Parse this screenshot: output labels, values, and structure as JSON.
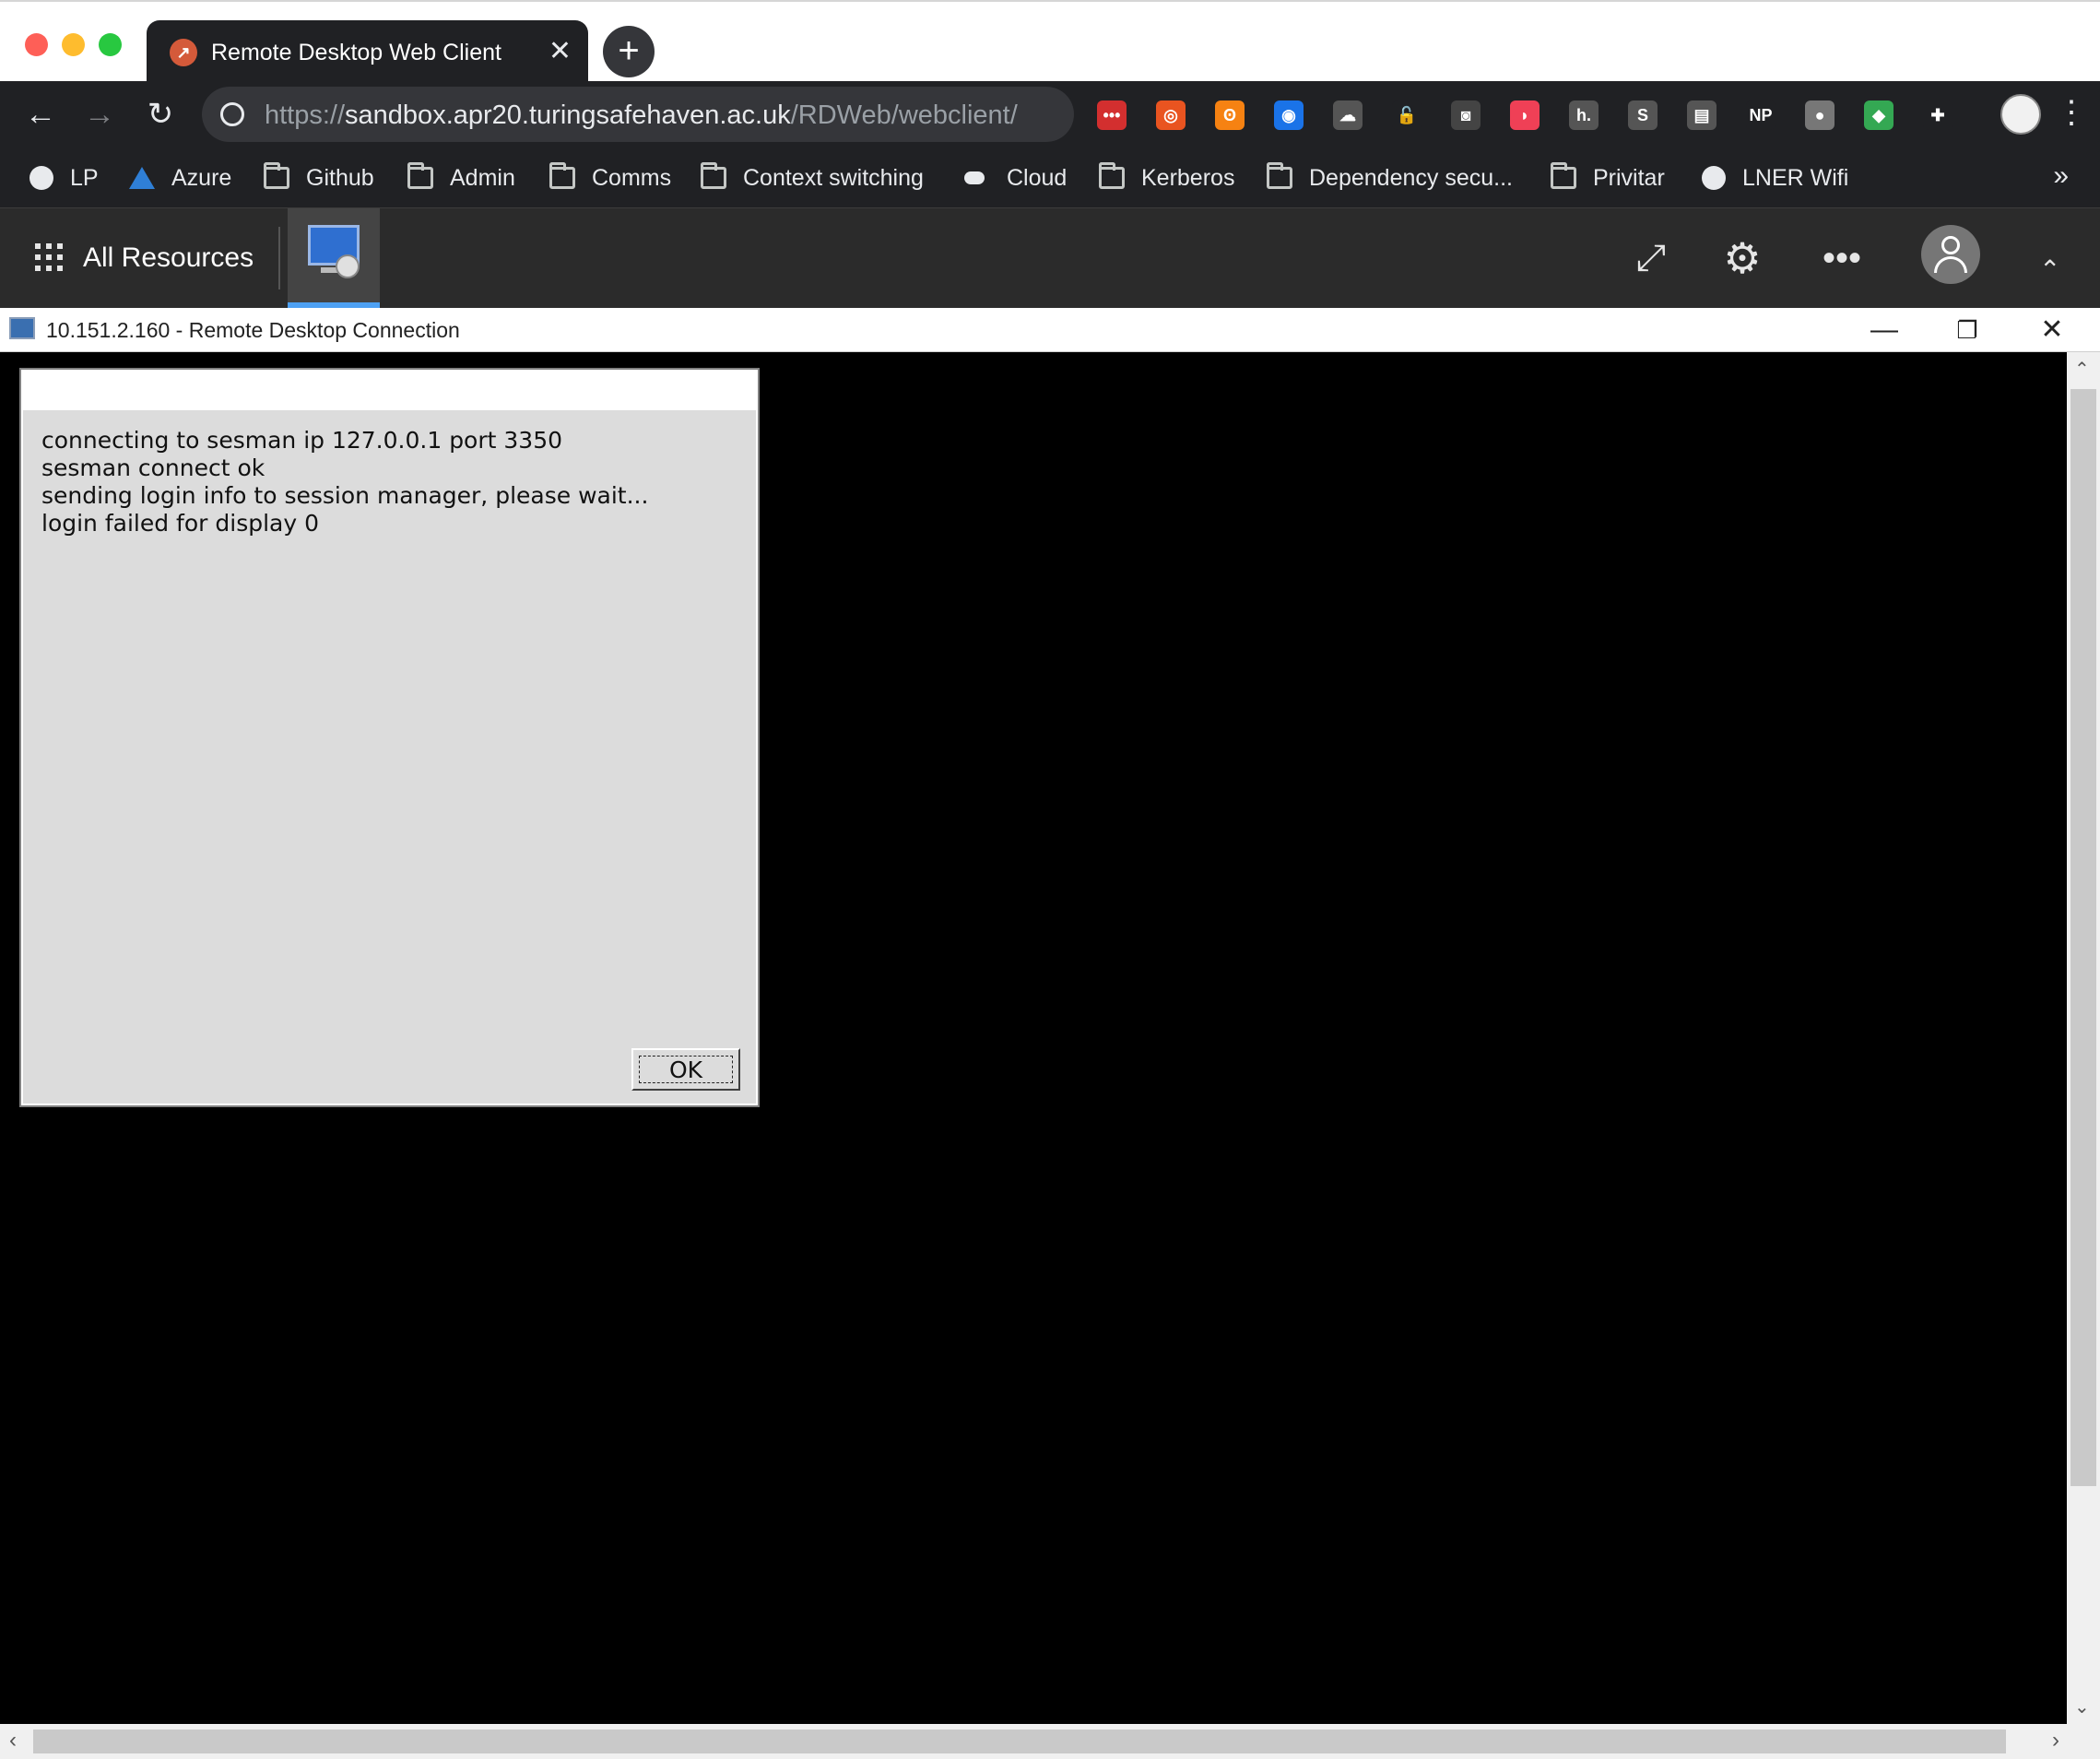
{
  "browser": {
    "tab_title": "Remote Desktop Web Client",
    "tab_close": "✕",
    "new_tab": "+",
    "url_scheme": "https://",
    "url_host": "sandbox.apr20.turingsafehaven.ac.uk",
    "url_path": "/RDWeb/webclient/",
    "extensions": [
      {
        "name": "lastpass-extension-icon",
        "glyph": "•••",
        "color": "#d32f2f"
      },
      {
        "name": "ubuntu-extension-icon",
        "glyph": "◎",
        "color": "#e95420"
      },
      {
        "name": "open-access-extension-icon",
        "glyph": "ʘ",
        "color": "#f68212"
      },
      {
        "name": "one-password-extension-icon",
        "glyph": "◉",
        "color": "#1a73e8"
      },
      {
        "name": "cloud-extension-icon",
        "glyph": "☁",
        "color": "#555555"
      },
      {
        "name": "lock-extension-icon",
        "glyph": "🔓",
        "color": "#202124"
      },
      {
        "name": "github-extension-icon",
        "glyph": "◙",
        "color": "#444444"
      },
      {
        "name": "pocket-extension-icon",
        "glyph": "◗",
        "color": "#ef4056"
      },
      {
        "name": "hypothesis-extension-icon",
        "glyph": "h.",
        "color": "#555555"
      },
      {
        "name": "skype-extension-icon",
        "glyph": "S",
        "color": "#555555"
      },
      {
        "name": "document-extension-icon",
        "glyph": "▤",
        "color": "#555555"
      },
      {
        "name": "np-extension-icon",
        "glyph": "NP",
        "color": "#202124"
      },
      {
        "name": "circle-extension-icon",
        "glyph": "●",
        "color": "#777777"
      },
      {
        "name": "colorful-extension-icon",
        "glyph": "◆",
        "color": "#34a853"
      },
      {
        "name": "puzzle-extension-icon",
        "glyph": "✚",
        "color": "#202124"
      }
    ],
    "more_menu": "⋮"
  },
  "bookmarks": [
    {
      "label": "LP",
      "icon": "globe"
    },
    {
      "label": "Azure",
      "icon": "azure"
    },
    {
      "label": "Github",
      "icon": "folder"
    },
    {
      "label": "Admin",
      "icon": "folder"
    },
    {
      "label": "Comms",
      "icon": "folder"
    },
    {
      "label": "Context switching",
      "icon": "folder"
    },
    {
      "label": "Cloud",
      "icon": "cloud"
    },
    {
      "label": "Kerberos",
      "icon": "folder"
    },
    {
      "label": "Dependency secu...",
      "icon": "folder"
    },
    {
      "label": "Privitar",
      "icon": "folder"
    },
    {
      "label": "LNER Wifi",
      "icon": "globe"
    }
  ],
  "bookmarks_overflow": "»",
  "rdclient": {
    "all_resources_label": "All Resources",
    "fullscreen_icon": "⤢",
    "settings_icon": "⚙",
    "more_icon": "•••",
    "collapse_icon": "⌃"
  },
  "remote_window": {
    "title": "10.151.2.160 - Remote Desktop Connection",
    "minimize": "—",
    "restore": "❐",
    "close": "✕"
  },
  "dialog": {
    "lines": [
      "connecting to sesman ip 127.0.0.1 port 3350",
      "sesman connect ok",
      "sending login info to session manager, please wait...",
      "login failed for display 0"
    ],
    "ok_label": "OK"
  },
  "scrollbars": {
    "up": "⌃",
    "down": "⌄",
    "left": "‹",
    "right": "›"
  }
}
